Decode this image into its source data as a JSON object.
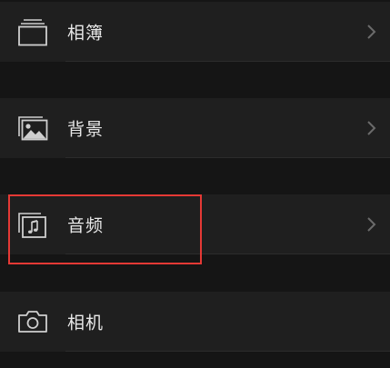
{
  "menu": {
    "items": [
      {
        "label": "相簿",
        "icon": "album-stack-icon",
        "has_chevron": true
      },
      {
        "label": "背景",
        "icon": "background-image-icon",
        "has_chevron": true
      },
      {
        "label": "音频",
        "icon": "audio-music-icon",
        "has_chevron": true,
        "highlighted": true
      },
      {
        "label": "相机",
        "icon": "camera-icon",
        "has_chevron": false
      }
    ]
  },
  "colors": {
    "background": "#151515",
    "row": "#1f1f1f",
    "text": "#e8e8e8",
    "icon": "#cfcfcf",
    "chevron": "#6b6b6b",
    "highlight": "#e53935"
  }
}
